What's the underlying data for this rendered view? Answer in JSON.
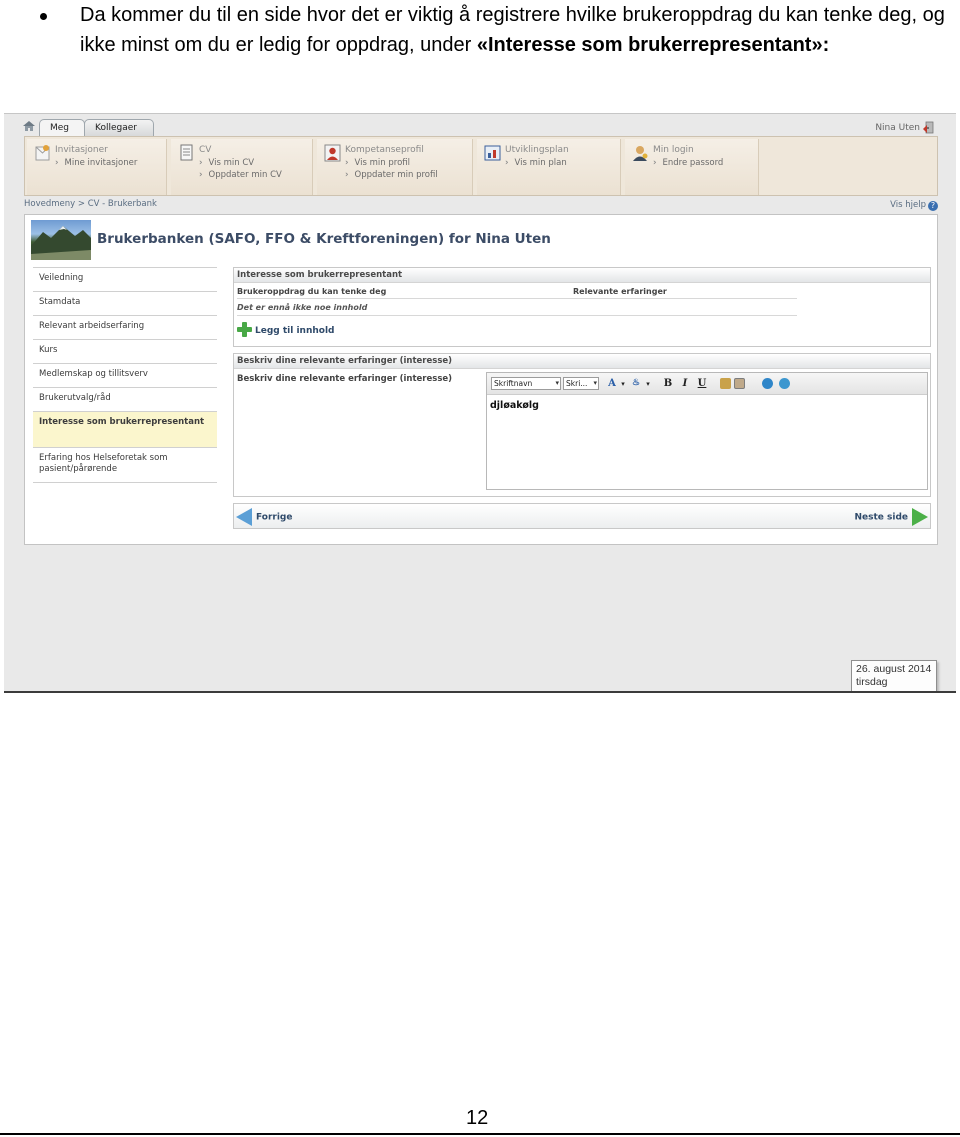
{
  "document": {
    "intro_text": "Da kommer du til en side hvor det er viktig å registrere hvilke brukeroppdrag du kan tenke deg, og ikke minst om du er ledig for oppdrag, under ",
    "intro_emphasis": "«Interesse som brukerrepresentant»:",
    "page_number": "12"
  },
  "app": {
    "tabs": [
      {
        "label": "Meg"
      },
      {
        "label": "Kollegaer"
      }
    ],
    "user_name": "Nina Uten",
    "menu": [
      {
        "title": "Invitasjoner",
        "links": [
          "Mine invitasjoner"
        ],
        "icon": "invitations-icon"
      },
      {
        "title": "CV",
        "links": [
          "Vis min CV",
          "Oppdater min CV"
        ],
        "icon": "document-icon"
      },
      {
        "title": "Kompetanseprofil",
        "links": [
          "Vis min profil",
          "Oppdater min profil"
        ],
        "icon": "profile-icon"
      },
      {
        "title": "Utviklingsplan",
        "links": [
          "Vis min plan"
        ],
        "icon": "plan-icon"
      },
      {
        "title": "Min login",
        "links": [
          "Endre passord"
        ],
        "icon": "login-icon"
      }
    ],
    "breadcrumb": "Hovedmeny  >  CV  -  Brukerbank",
    "help_label": "Vis hjelp",
    "page_title": "Brukerbanken (SAFO, FFO & Kreftforeningen) for Nina Uten",
    "sidebar": [
      {
        "label": "Veiledning",
        "active": false
      },
      {
        "label": "Stamdata",
        "active": false
      },
      {
        "label": "Relevant arbeidserfaring",
        "active": false
      },
      {
        "label": "Kurs",
        "active": false
      },
      {
        "label": "Medlemskap og tillitsverv",
        "active": false
      },
      {
        "label": "Brukerutvalg/råd",
        "active": false
      },
      {
        "label": "Interesse som brukerrepresentant",
        "active": true
      },
      {
        "label": "Erfaring hos Helseforetak som pasient/pårørende",
        "active": false
      }
    ],
    "interest_section": {
      "title": "Interesse som brukerrepresentant",
      "col_assignments": "Brukeroppdrag du kan tenke deg",
      "col_experience": "Relevante erfaringer",
      "empty_note": "Det er ennå ikke noe innhold",
      "add_label": "Legg til innhold"
    },
    "experience_section": {
      "title": "Beskriv dine relevante erfaringer (interesse)",
      "field_label": "Beskriv dine relevante erfaringer (interesse)",
      "font_select": "Skriftnavn",
      "size_select": "Skri...",
      "editor_text": "djløakølg"
    },
    "nav": {
      "prev_label": "Forrige",
      "next_label": "Neste side"
    },
    "date": {
      "date": "26. august 2014",
      "weekday": "tirsdag"
    }
  }
}
